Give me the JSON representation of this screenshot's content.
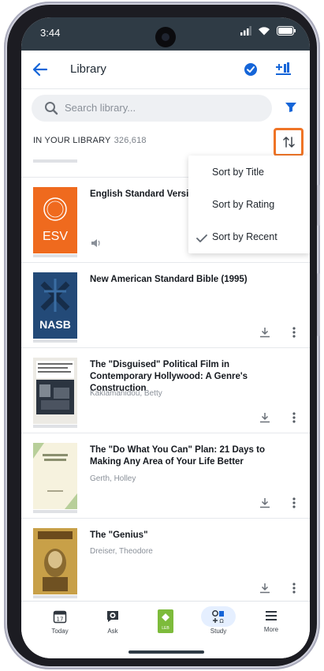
{
  "status": {
    "time": "3:44"
  },
  "header": {
    "title": "Library"
  },
  "search": {
    "placeholder": "Search library..."
  },
  "library": {
    "label": "IN YOUR LIBRARY",
    "count": "326,618"
  },
  "sort_menu": {
    "options": [
      "Sort by Title",
      "Sort by Rating",
      "Sort by Recent"
    ],
    "selected": "Sort by Recent"
  },
  "books": [
    {
      "title": "English Standard Version",
      "author": "",
      "cover_text": "ESV",
      "cover_color": "#ef6a1e"
    },
    {
      "title": "New American Standard Bible (1995)",
      "author": "",
      "cover_text": "NASB",
      "cover_color": "#2c5a8e"
    },
    {
      "title": "The \"Disguised\" Political Film in Contemporary Hollywood: A Genre's Construction",
      "author": "Kaklamanidou, Betty",
      "cover_text": "",
      "cover_color": "#1d2a3a"
    },
    {
      "title": "The \"Do What You Can\" Plan: 21 Days to Making Any Area of Your Life Better",
      "author": "Gerth, Holley",
      "cover_text": "",
      "cover_color": "#f3efd9"
    },
    {
      "title": "The \"Genius\"",
      "author": "Dreiser, Theodore",
      "cover_text": "",
      "cover_color": "#c99f36"
    }
  ],
  "tabs": [
    {
      "label": "Today"
    },
    {
      "label": "Ask"
    },
    {
      "label": "LEB"
    },
    {
      "label": "Study"
    },
    {
      "label": "More"
    }
  ],
  "colors": {
    "accent": "#1565d8",
    "highlight": "#ef7426",
    "leb_green": "#7dbb3b"
  }
}
